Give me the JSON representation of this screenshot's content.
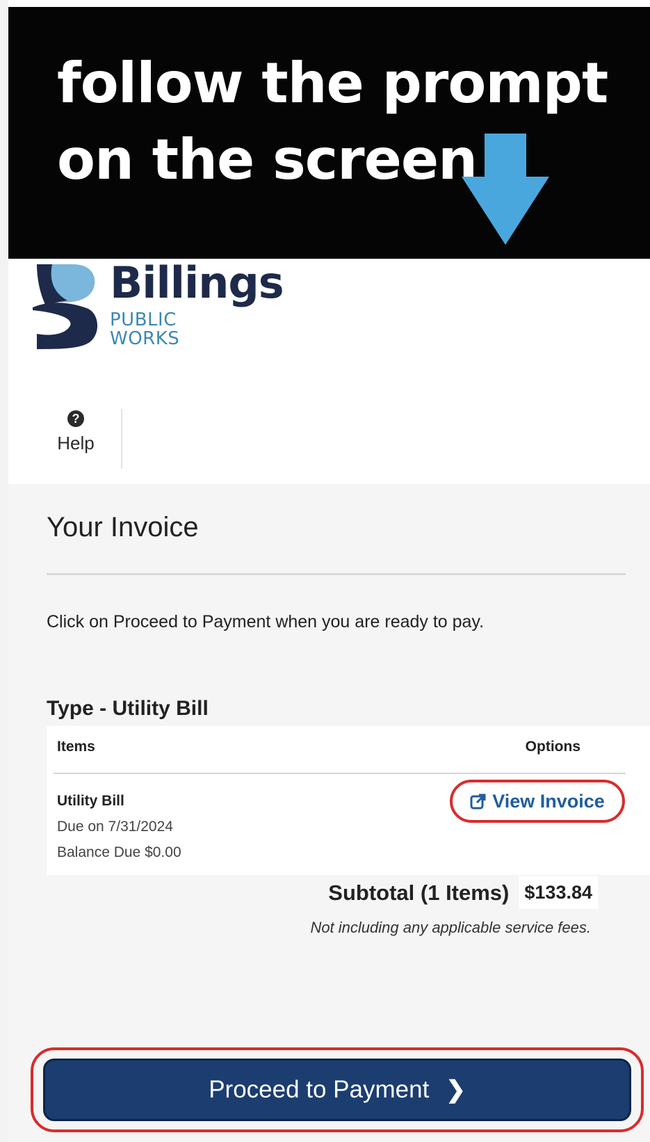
{
  "banner": {
    "line1": "follow the prompt",
    "line2": "on the screen",
    "arrow_color": "#4aa7dd"
  },
  "header": {
    "brand_name": "Billings",
    "brand_sub1": "PUBLIC",
    "brand_sub2": "WORKS",
    "help_icon": "question-circle-icon",
    "help_label": "Help"
  },
  "invoice": {
    "title": "Your Invoice",
    "instruction": "Click on Proceed to Payment when you are ready to pay.",
    "type_heading": "Type - Utility Bill",
    "columns": {
      "items": "Items",
      "options": "Options"
    },
    "row": {
      "name": "Utility Bill",
      "due": "Due on 7/31/2024",
      "balance": "Balance Due $0.00",
      "view_label": "View Invoice",
      "view_icon": "external-link-icon"
    },
    "subtotal_label": "Subtotal (1 Items)",
    "subtotal_amount": "$133.84",
    "fee_note": "Not including any applicable service fees.",
    "proceed_label": "Proceed to Payment",
    "proceed_icon": "chevron-right-icon"
  },
  "colors": {
    "primary_button": "#1b3d70",
    "highlight_outline": "#d92c2c",
    "link": "#1f5d9e",
    "brand_dark": "#1e2a4a",
    "brand_light": "#3d88b0"
  }
}
